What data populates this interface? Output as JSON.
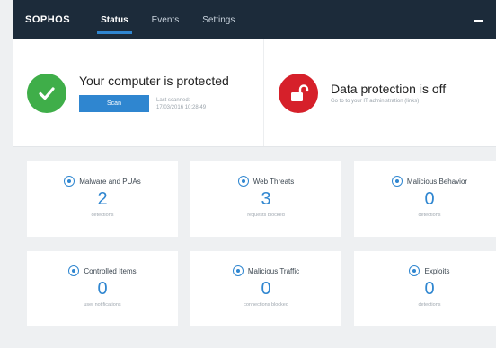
{
  "app": {
    "logo": "SOPHOS"
  },
  "nav": [
    {
      "label": "Status",
      "active": true
    },
    {
      "label": "Events",
      "active": false
    },
    {
      "label": "Settings",
      "active": false
    }
  ],
  "status": {
    "protected_title": "Your computer is protected",
    "scan_button": "Scan",
    "last_scan_label": "Last scanned:",
    "last_scan_time": "17/03/2016 10:28:49",
    "data_title": "Data protection is off",
    "data_subtitle": "Go to to your IT administration (links)"
  },
  "cards": [
    {
      "title": "Malware and PUAs",
      "value": "2",
      "caption": "detections",
      "icon": "malware-icon"
    },
    {
      "title": "Web Threats",
      "value": "3",
      "caption": "requests blocked",
      "icon": "globe-icon"
    },
    {
      "title": "Malicious Behavior",
      "value": "0",
      "caption": "detections",
      "icon": "behavior-icon"
    },
    {
      "title": "Controlled Items",
      "value": "0",
      "caption": "user notifications",
      "icon": "controlled-items-icon"
    },
    {
      "title": "Malicious Traffic",
      "value": "0",
      "caption": "connections blocked",
      "icon": "traffic-icon"
    },
    {
      "title": "Exploits",
      "value": "0",
      "caption": "detections",
      "icon": "exploit-icon"
    }
  ],
  "colors": {
    "topbar": "#1c2b3a",
    "accent": "#2f86d0",
    "ok": "#3fae49",
    "alert": "#d6202a"
  }
}
